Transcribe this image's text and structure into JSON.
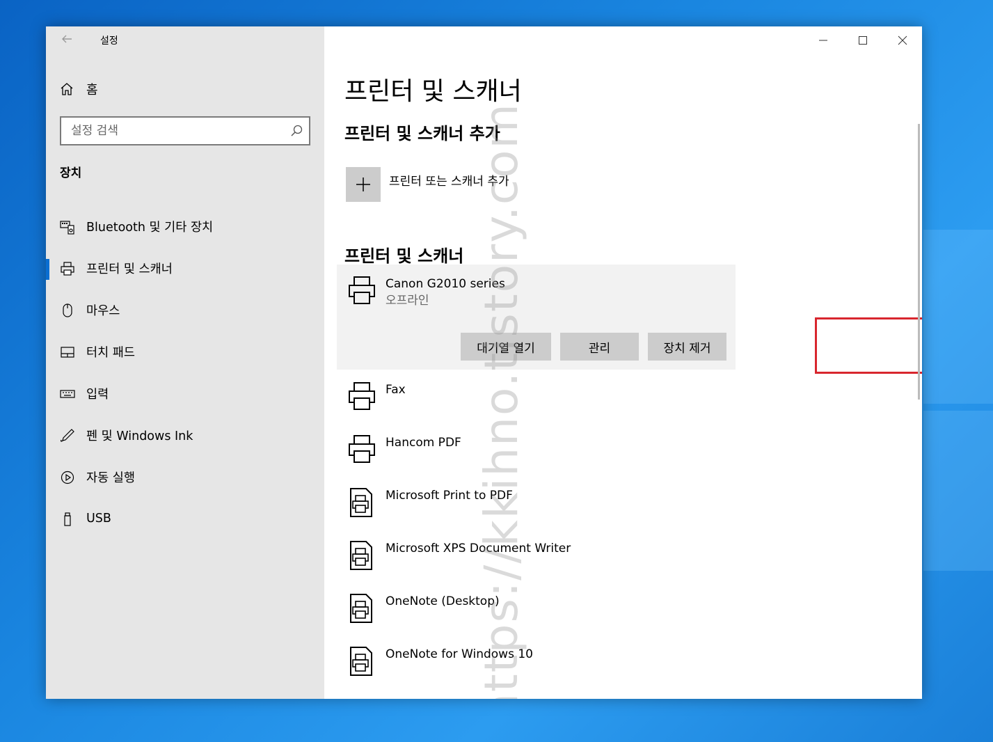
{
  "window": {
    "app_title": "설정",
    "controls": {
      "minimize": "minimize-icon",
      "maximize": "maximize-icon",
      "close": "close-icon"
    }
  },
  "sidebar": {
    "home_label": "홈",
    "search_placeholder": "설정 검색",
    "section_title": "장치",
    "items": [
      {
        "label": "Bluetooth 및 기타 장치",
        "icon": "bluetooth-devices-icon",
        "active": false
      },
      {
        "label": "프린터 및 스캐너",
        "icon": "printer-icon",
        "active": true
      },
      {
        "label": "마우스",
        "icon": "mouse-icon",
        "active": false
      },
      {
        "label": "터치 패드",
        "icon": "touchpad-icon",
        "active": false
      },
      {
        "label": "입력",
        "icon": "keyboard-icon",
        "active": false
      },
      {
        "label": "펜 및 Windows Ink",
        "icon": "pen-icon",
        "active": false
      },
      {
        "label": "자동 실행",
        "icon": "autoplay-icon",
        "active": false
      },
      {
        "label": "USB",
        "icon": "usb-icon",
        "active": false
      }
    ]
  },
  "main": {
    "page_title": "프린터 및 스캐너",
    "add_section_title": "프린터 및 스캐너 추가",
    "add_button_label": "프린터 또는 스캐너 추가",
    "list_title": "프린터 및 스캐너",
    "selected_printer": {
      "name": "Canon G2010 series",
      "status": "오프라인",
      "buttons": {
        "open_queue": "대기열 열기",
        "manage": "관리",
        "remove": "장치 제거"
      }
    },
    "printers": [
      {
        "name": "Fax",
        "icon": "printer-icon"
      },
      {
        "name": "Hancom PDF",
        "icon": "printer-icon"
      },
      {
        "name": "Microsoft Print to PDF",
        "icon": "document-printer-icon"
      },
      {
        "name": "Microsoft XPS Document Writer",
        "icon": "document-printer-icon"
      },
      {
        "name": "OneNote (Desktop)",
        "icon": "document-printer-icon"
      },
      {
        "name": "OneNote for Windows 10",
        "icon": "document-printer-icon"
      }
    ]
  },
  "watermark": "https://kkihno.tistory.com",
  "colors": {
    "accent": "#0a6ed1",
    "highlight": "#d8262e",
    "sidebar_bg": "#e6e6e6"
  }
}
